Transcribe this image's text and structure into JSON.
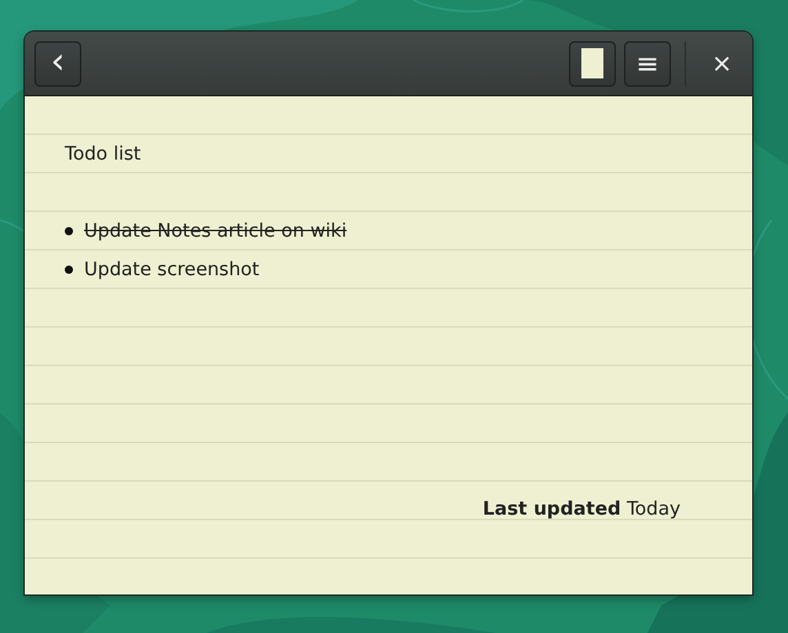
{
  "header": {
    "back": "‹",
    "color_button": {
      "color": "#eef0d1"
    },
    "menu": "≡",
    "close": "×"
  },
  "note": {
    "lines": [
      {
        "kind": "blank"
      },
      {
        "kind": "text",
        "text": "Todo list"
      },
      {
        "kind": "blank"
      },
      {
        "kind": "bullet",
        "text": "Update Notes article on wiki",
        "done": true
      },
      {
        "kind": "bullet",
        "text": "Update screenshot",
        "done": false
      }
    ]
  },
  "footer": "**Last updated** Today"
}
